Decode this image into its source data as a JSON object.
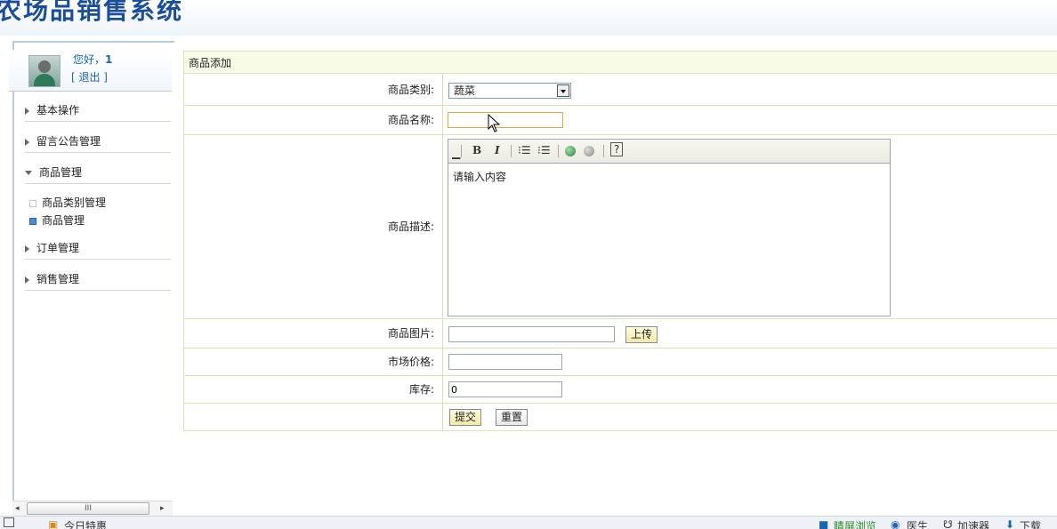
{
  "header": {
    "title": "农场品销售系统"
  },
  "user": {
    "greeting": "您好，",
    "username": "1",
    "logout": "[ 退出 ]"
  },
  "sidebar": {
    "items": [
      {
        "label": "基本操作",
        "expanded": false
      },
      {
        "label": "留言公告管理",
        "expanded": false
      },
      {
        "label": "商品管理",
        "expanded": true
      },
      {
        "label": "订单管理",
        "expanded": false
      },
      {
        "label": "销售管理",
        "expanded": false
      }
    ],
    "subitems": [
      {
        "label": "商品类别管理",
        "active": false
      },
      {
        "label": "商品管理",
        "active": true
      }
    ]
  },
  "scrollbar": {
    "left": "◂",
    "thumb": "III",
    "right": "▸"
  },
  "form": {
    "title": "商品添加",
    "category_label": "商品类别:",
    "category_value": "蔬菜",
    "name_label": "商品名称:",
    "name_value": "",
    "desc_label": "商品描述:",
    "desc_placeholder": "请输入内容",
    "image_label": "商品图片:",
    "image_value": "",
    "upload_label": "上传",
    "price_label": "市场价格:",
    "price_value": "",
    "stock_label": "库存:",
    "stock_value": "0",
    "submit_label": "提交",
    "reset_label": "重置"
  },
  "editor_toolbar": {
    "bold": "B",
    "italic": "I",
    "ordered_list": "⁝☰",
    "unordered_list": "⁝☰",
    "help": "?"
  },
  "statusbar": {
    "left_item": "今日特惠",
    "items": [
      "睛屏浏览",
      "医生",
      "加速器",
      "下载"
    ]
  },
  "colors": {
    "accent": "#1a4e9c",
    "row_border": "#d8e4b4",
    "title_bg": "#f8fbe6"
  }
}
